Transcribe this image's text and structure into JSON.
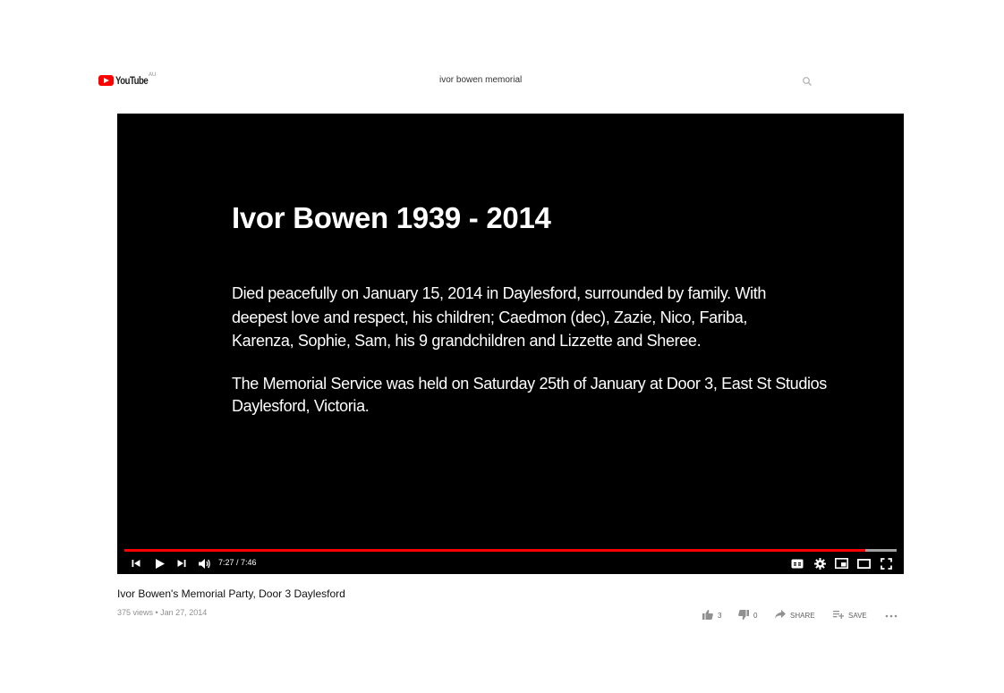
{
  "header": {
    "logo_text": "YouTube",
    "region": "AU",
    "search_value": "ivor bowen memorial",
    "search_icon": "search-icon"
  },
  "player": {
    "slide": {
      "title": "Ivor Bowen 1939 - 2014",
      "paragraph1": [
        "Died peacefully on January 15, 2014 in Daylesford, surrounded by family. With",
        "deepest love and respect, his children; Caedmon (dec), Zazie, Nico, Fariba,",
        "Karenza, Sophie, Sam, his 9 grandchildren and Lizzette and Sheree."
      ],
      "paragraph2": [
        "The Memorial Service was held on Saturday 25th of January at Door 3, East St Studios",
        "Daylesford, Victoria."
      ]
    },
    "time_display": "7:27 / 7:46",
    "played_fraction": 0.96,
    "buffered_fraction": 1.0,
    "accent_color": "#ff0000"
  },
  "video": {
    "title": "Ivor Bowen's Memorial Party, Door 3 Daylesford",
    "meta": "375 views • Jan 27, 2014",
    "like_count": "3",
    "dislike_count": "0",
    "share_label": "SHARE",
    "save_label": "SAVE"
  }
}
